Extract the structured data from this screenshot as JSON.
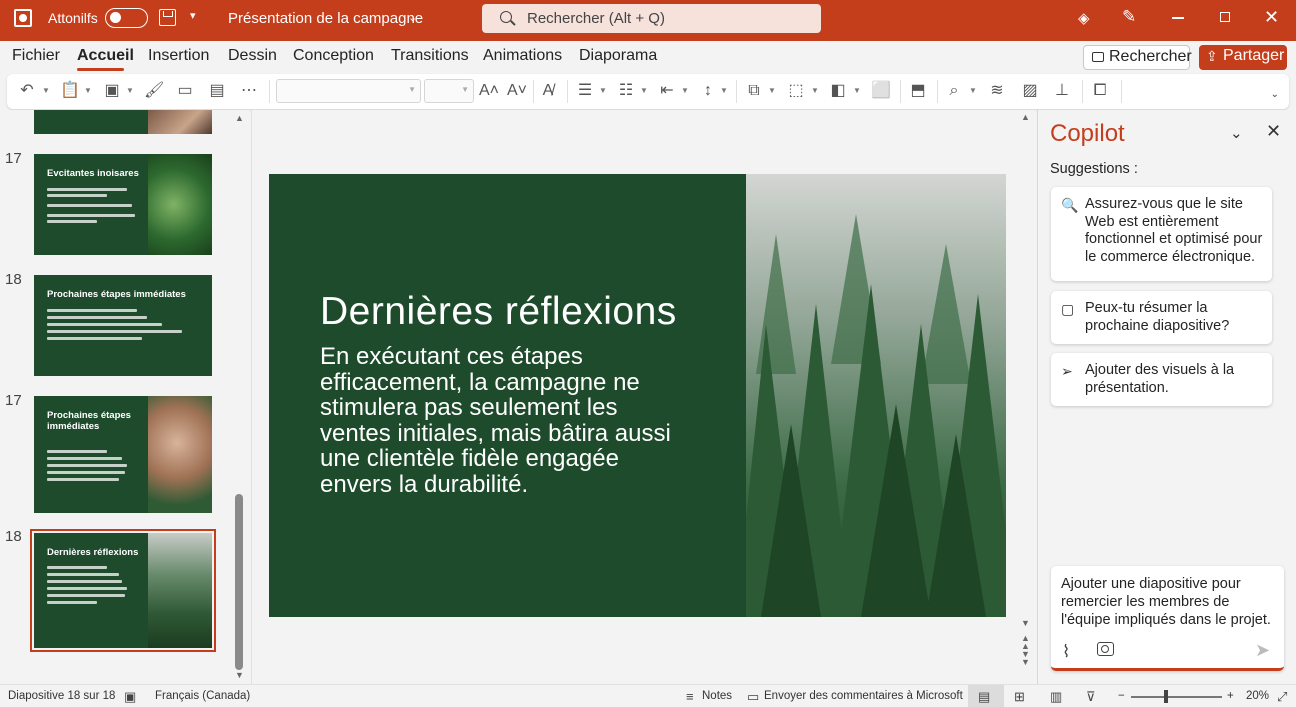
{
  "titlebar": {
    "autosave_label": "Attonilfs",
    "document_name": "Présentation de la campagne",
    "search_placeholder": "Rechercher (Alt + Q)"
  },
  "menu": {
    "items": [
      "Fichier",
      "Accueil",
      "Insertion",
      "Dessin",
      "Conception",
      "Transitions",
      "Animations",
      "Diaporama"
    ],
    "active": "Accueil",
    "rechercher_label": "Rechercher",
    "partager_label": "Partager"
  },
  "thumbnails": [
    {
      "number": "17",
      "title": "Evcitantes inoisares"
    },
    {
      "number": "18",
      "title": "Prochaines étapes immédiates"
    },
    {
      "number": "17",
      "title": "Prochaines étapes immédiates"
    },
    {
      "number": "18",
      "title": "Dernières réflexions"
    }
  ],
  "slide": {
    "title": "Dernières réflexions",
    "body": "En exécutant ces étapes efficacement, la campagne ne stimulera pas seulement les ventes initiales, mais bâtira aussi une clientèle fidèle engagée envers la durabilité."
  },
  "copilot": {
    "title": "Copilot",
    "suggestions_label": "Suggestions :",
    "suggestions": [
      "Assurez-vous que le site Web est entièrement fonctionnel et optimisé pour le commerce électronique.",
      "Peux-tu résumer la prochaine diapositive?",
      "Ajouter des visuels à la présentation."
    ],
    "input_text": "Ajouter une diapositive pour remercier les membres de l'équipe impliqués dans le projet."
  },
  "statusbar": {
    "slide_counter": "Diapositive 18 sur 18",
    "language": "Français (Canada)",
    "notes_label": "Notes",
    "feedback_label": "Envoyer des commentaires à Microsoft",
    "zoom_minus": "−",
    "zoom_plus": "+",
    "zoom_percent": "20%"
  },
  "colors": {
    "accent": "#c43e1c",
    "slide_background": "#1d4b2b"
  }
}
